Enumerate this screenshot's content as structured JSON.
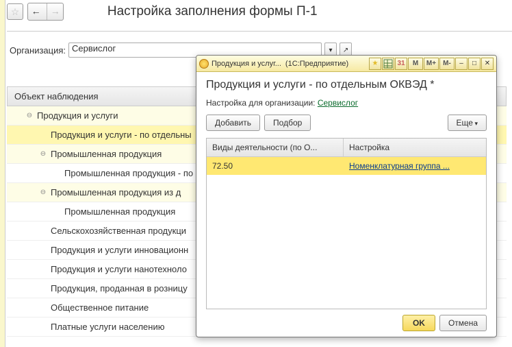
{
  "main": {
    "title": "Настройка заполнения формы П-1",
    "org_label": "Организация:",
    "org_value": "Сервислог",
    "tree_header": "Объект наблюдения",
    "tree": [
      {
        "level": 1,
        "exp": "⊖",
        "label": "Продукция и услуги",
        "cls": "hov"
      },
      {
        "level": 2,
        "exp": "",
        "label": "Продукция и услуги - по отдельны",
        "cls": "sel"
      },
      {
        "level": 2,
        "exp": "⊖",
        "label": "Промышленная продукция",
        "cls": "hov"
      },
      {
        "level": 3,
        "exp": "",
        "label": "Промышленная продукция - по",
        "cls": ""
      },
      {
        "level": 2,
        "exp": "⊖",
        "label": "Промышленная продукция из д",
        "cls": "hov"
      },
      {
        "level": 3,
        "exp": "",
        "label": "Промышленная продукция",
        "cls": ""
      },
      {
        "level": 2,
        "exp": "",
        "label": "Сельскохозяйственная продукци",
        "cls": ""
      },
      {
        "level": 2,
        "exp": "",
        "label": "Продукция и услуги инновационн",
        "cls": ""
      },
      {
        "level": 2,
        "exp": "",
        "label": "Продукция и услуги нанотехноло",
        "cls": ""
      },
      {
        "level": 2,
        "exp": "",
        "label": "Продукция, проданная в розницу",
        "cls": ""
      },
      {
        "level": 2,
        "exp": "",
        "label": "Общественное питание",
        "cls": ""
      },
      {
        "level": 2,
        "exp": "",
        "label": "Платные услуги населению",
        "cls": ""
      }
    ]
  },
  "dialog": {
    "titlebar_1": "Продукция и услуг...",
    "titlebar_2": "(1С:Предприятие)",
    "m_btns": [
      "M",
      "M+",
      "M-"
    ],
    "heading": "Продукция и услуги - по отдельным ОКВЭД *",
    "org_prefix": "Настройка для организации: ",
    "org_link": "Сервислог",
    "btn_add": "Добавить",
    "btn_pick": "Подбор",
    "btn_more": "Еще",
    "col1": "Виды деятельности (по О...",
    "col2": "Настройка",
    "row": {
      "code": "72.50",
      "link": "Номенклатурная группа ..."
    },
    "ok": "OK",
    "cancel": "Отмена"
  }
}
